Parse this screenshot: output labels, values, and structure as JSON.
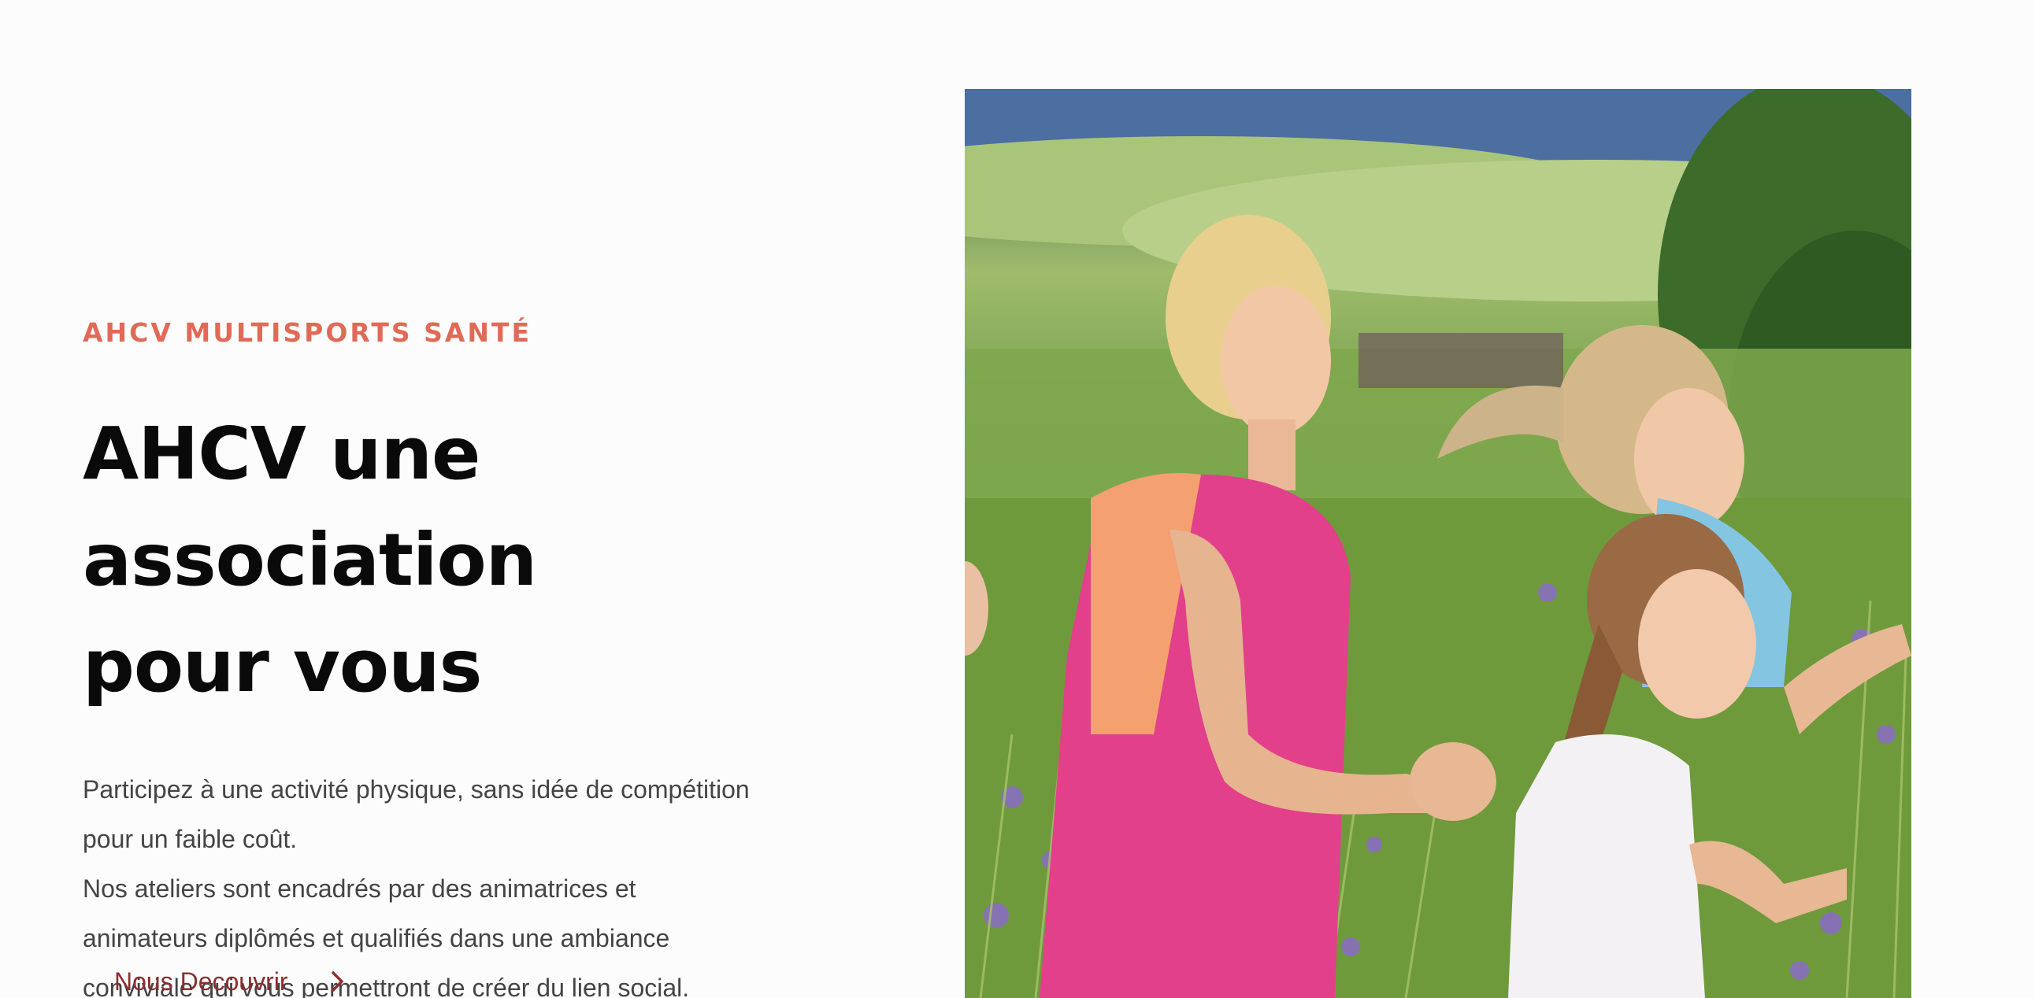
{
  "hero": {
    "eyebrow": "AHCV MULTISPORTS SANTÉ",
    "title_line1": "AHCV une association",
    "title_line2": "pour vous",
    "paragraph1_line1": "Participez à une activité physique, sans idée de compétition",
    "paragraph1_line2": "pour un faible coût.",
    "paragraph2_line1": "Nos ateliers sont encadrés par des animatrices et",
    "paragraph2_line2": "animateurs diplômés et qualifiés dans une ambiance",
    "paragraph2_line3": "conviviale qui vous permettront de créer du lien social.",
    "cta_label": "Nous Decouvrir",
    "cta_icon": "chevron-right-icon"
  },
  "colors": {
    "accent": "#e06a57",
    "cta": "#8a2f2f",
    "heading": "#0a0a0a",
    "body": "#444444",
    "background": "#fcfcfc"
  }
}
